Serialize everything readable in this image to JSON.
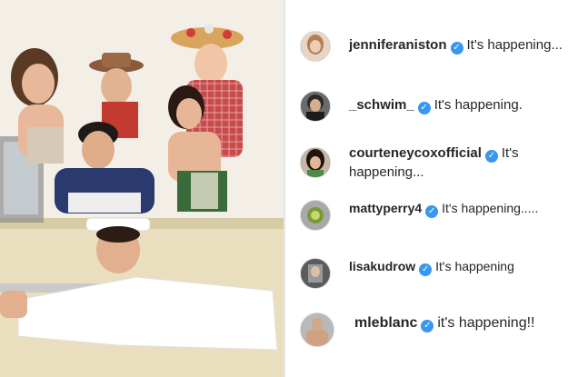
{
  "comments": [
    {
      "username": "jenniferaniston",
      "text": "It's happening..."
    },
    {
      "username": "_schwim_",
      "text": "It's happening."
    },
    {
      "username": "courteneycoxofficial",
      "text": "It's happening..."
    },
    {
      "username": "mattyperry4",
      "text": "It's happening....."
    },
    {
      "username": "lisakudrow",
      "text": "It's happening"
    },
    {
      "username": "mleblanc",
      "text": "it's happening!!"
    }
  ],
  "verified_badge_icon": "verified-badge-icon",
  "colors": {
    "verified": "#3897f0",
    "text": "#262626"
  }
}
